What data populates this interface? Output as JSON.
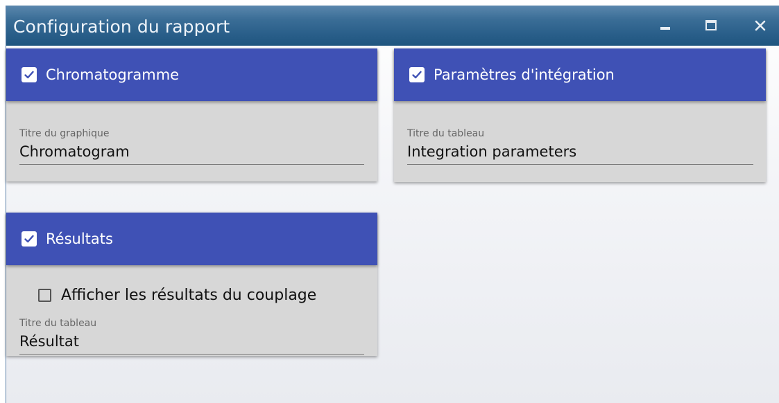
{
  "window": {
    "title": "Configuration du rapport",
    "controls": [
      "minimize-icon",
      "maximize-icon",
      "close-icon"
    ]
  },
  "colors": {
    "card_header": "#3f51b5",
    "card_body": "#d7d7d7",
    "titlebar": "#2a5f8a"
  },
  "cards": {
    "chromatogram": {
      "checked": true,
      "label": "Chromatogramme",
      "field_label": "Titre du graphique",
      "field_value": "Chromatogram"
    },
    "integration": {
      "checked": true,
      "label": "Paramètres d'intégration",
      "field_label": "Titre du tableau",
      "field_value": "Integration parameters"
    },
    "results": {
      "checked": true,
      "label": "Résultats",
      "option_label": "Afficher les résultats du couplage",
      "option_checked": false,
      "field_label": "Titre du tableau",
      "field_value": "Résultat"
    }
  }
}
